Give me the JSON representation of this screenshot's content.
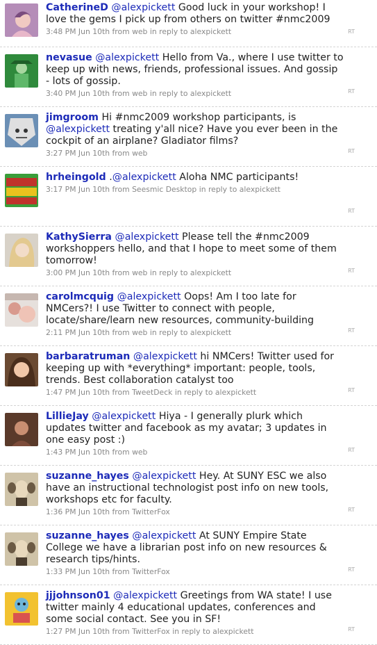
{
  "tweets": [
    {
      "user": "CatherineD",
      "mention": "@alexpickett",
      "text": " Good luck in your workshop! I love the gems I pick up from others on twitter #nmc2009",
      "time": "3:48 PM Jun 10th",
      "via": "from",
      "source": "web",
      "reply_prefix": "in reply to",
      "reply_to": "alexpickett",
      "rt": "RT",
      "avatar": "avatar-catherined"
    },
    {
      "user": "nevasue",
      "mention": "@alexpickett",
      "text": " Hello from Va., where I use twitter to keep up with news, friends, professional issues. And gossip - lots of gossip.",
      "time": "3:40 PM Jun 10th",
      "via": "from",
      "source": "web",
      "reply_prefix": "in reply to",
      "reply_to": "alexpickett",
      "rt": "RT",
      "avatar": "avatar-nevasue"
    },
    {
      "user": "jimgroom",
      "mention": "@alexpickett",
      "pre": " Hi #nmc2009 workshop participants, is ",
      "text": " treating y'all nice? Have you ever been in the cockpit of an airplane? Gladiator films?",
      "time": "3:27 PM Jun 10th",
      "via": "from",
      "source": "web",
      "reply_prefix": "",
      "reply_to": "",
      "rt": "RT",
      "avatar": "avatar-jimgroom"
    },
    {
      "user": "hrheingold",
      "mention": "@alexpickett",
      "pre": " .",
      "text": " Aloha NMC participants!",
      "time": "3:17 PM Jun 10th",
      "via": "from",
      "source": "Seesmic Desktop",
      "reply_prefix": "in reply to",
      "reply_to": "alexpickett",
      "rt": "RT",
      "avatar": "avatar-hrheingold"
    },
    {
      "user": "KathySierra",
      "mention": "@alexpickett",
      "text": " Please tell the #nmc2009 workshoppers hello, and that I hope to meet some of them tomorrow!",
      "time": "3:00 PM Jun 10th",
      "via": "from",
      "source": "web",
      "reply_prefix": "in reply to",
      "reply_to": "alexpickett",
      "rt": "RT",
      "avatar": "avatar-kathysierra"
    },
    {
      "user": "carolmcquig",
      "mention": "@alexpickett",
      "text": " Oops! Am I too late for NMCers?! I use Twitter to connect with people, locate/share/learn new resources, community-building",
      "time": "2:11 PM Jun 10th",
      "via": "from",
      "source": "web",
      "reply_prefix": "in reply to",
      "reply_to": "alexpickett",
      "rt": "RT",
      "avatar": "avatar-carolmcquig"
    },
    {
      "user": "barbaratruman",
      "mention": "@alexpickett",
      "text": " hi NMCers! Twitter used for keeping up with *everything* important: people, tools, trends. Best collaboration catalyst too",
      "time": "1:47 PM Jun 10th",
      "via": "from",
      "source": "TweetDeck",
      "reply_prefix": "in reply to",
      "reply_to": "alexpickett",
      "rt": "RT",
      "avatar": "avatar-barbaratruman"
    },
    {
      "user": "LillieJay",
      "mention": "@alexpickett",
      "text": " Hiya - I generally plurk which updates twitter and facebook as my avatar; 3 updates in one easy post :)",
      "time": "1:43 PM Jun 10th",
      "via": "from",
      "source": "web",
      "reply_prefix": "",
      "reply_to": "",
      "rt": "RT",
      "avatar": "avatar-lilliejay"
    },
    {
      "user": "suzanne_hayes",
      "mention": "@alexpickett",
      "text": " Hey. At SUNY ESC we also have an instructional technologist post info on new tools, workshops etc for faculty.",
      "time": "1:36 PM Jun 10th",
      "via": "from",
      "source": "TwitterFox",
      "reply_prefix": "",
      "reply_to": "",
      "rt": "RT",
      "avatar": "avatar-suzanne-hayes"
    },
    {
      "user": "suzanne_hayes",
      "mention": "@alexpickett",
      "text": " At SUNY Empire State College we have a librarian post info on new resources & research tips/hints.",
      "time": "1:33 PM Jun 10th",
      "via": "from",
      "source": "TwitterFox",
      "reply_prefix": "",
      "reply_to": "",
      "rt": "RT",
      "avatar": "avatar-suzanne-hayes"
    },
    {
      "user": "jjjohnson01",
      "mention": "@alexpickett",
      "text": " Greetings from WA state! I use twitter mainly 4 educational updates, conferences and some social contact. See you in SF!",
      "time": "1:27 PM Jun 10th",
      "via": "from",
      "source": "TwitterFox",
      "reply_prefix": "in reply to",
      "reply_to": "alexpickett",
      "rt": "RT",
      "avatar": "avatar-jjjohnson01"
    }
  ]
}
